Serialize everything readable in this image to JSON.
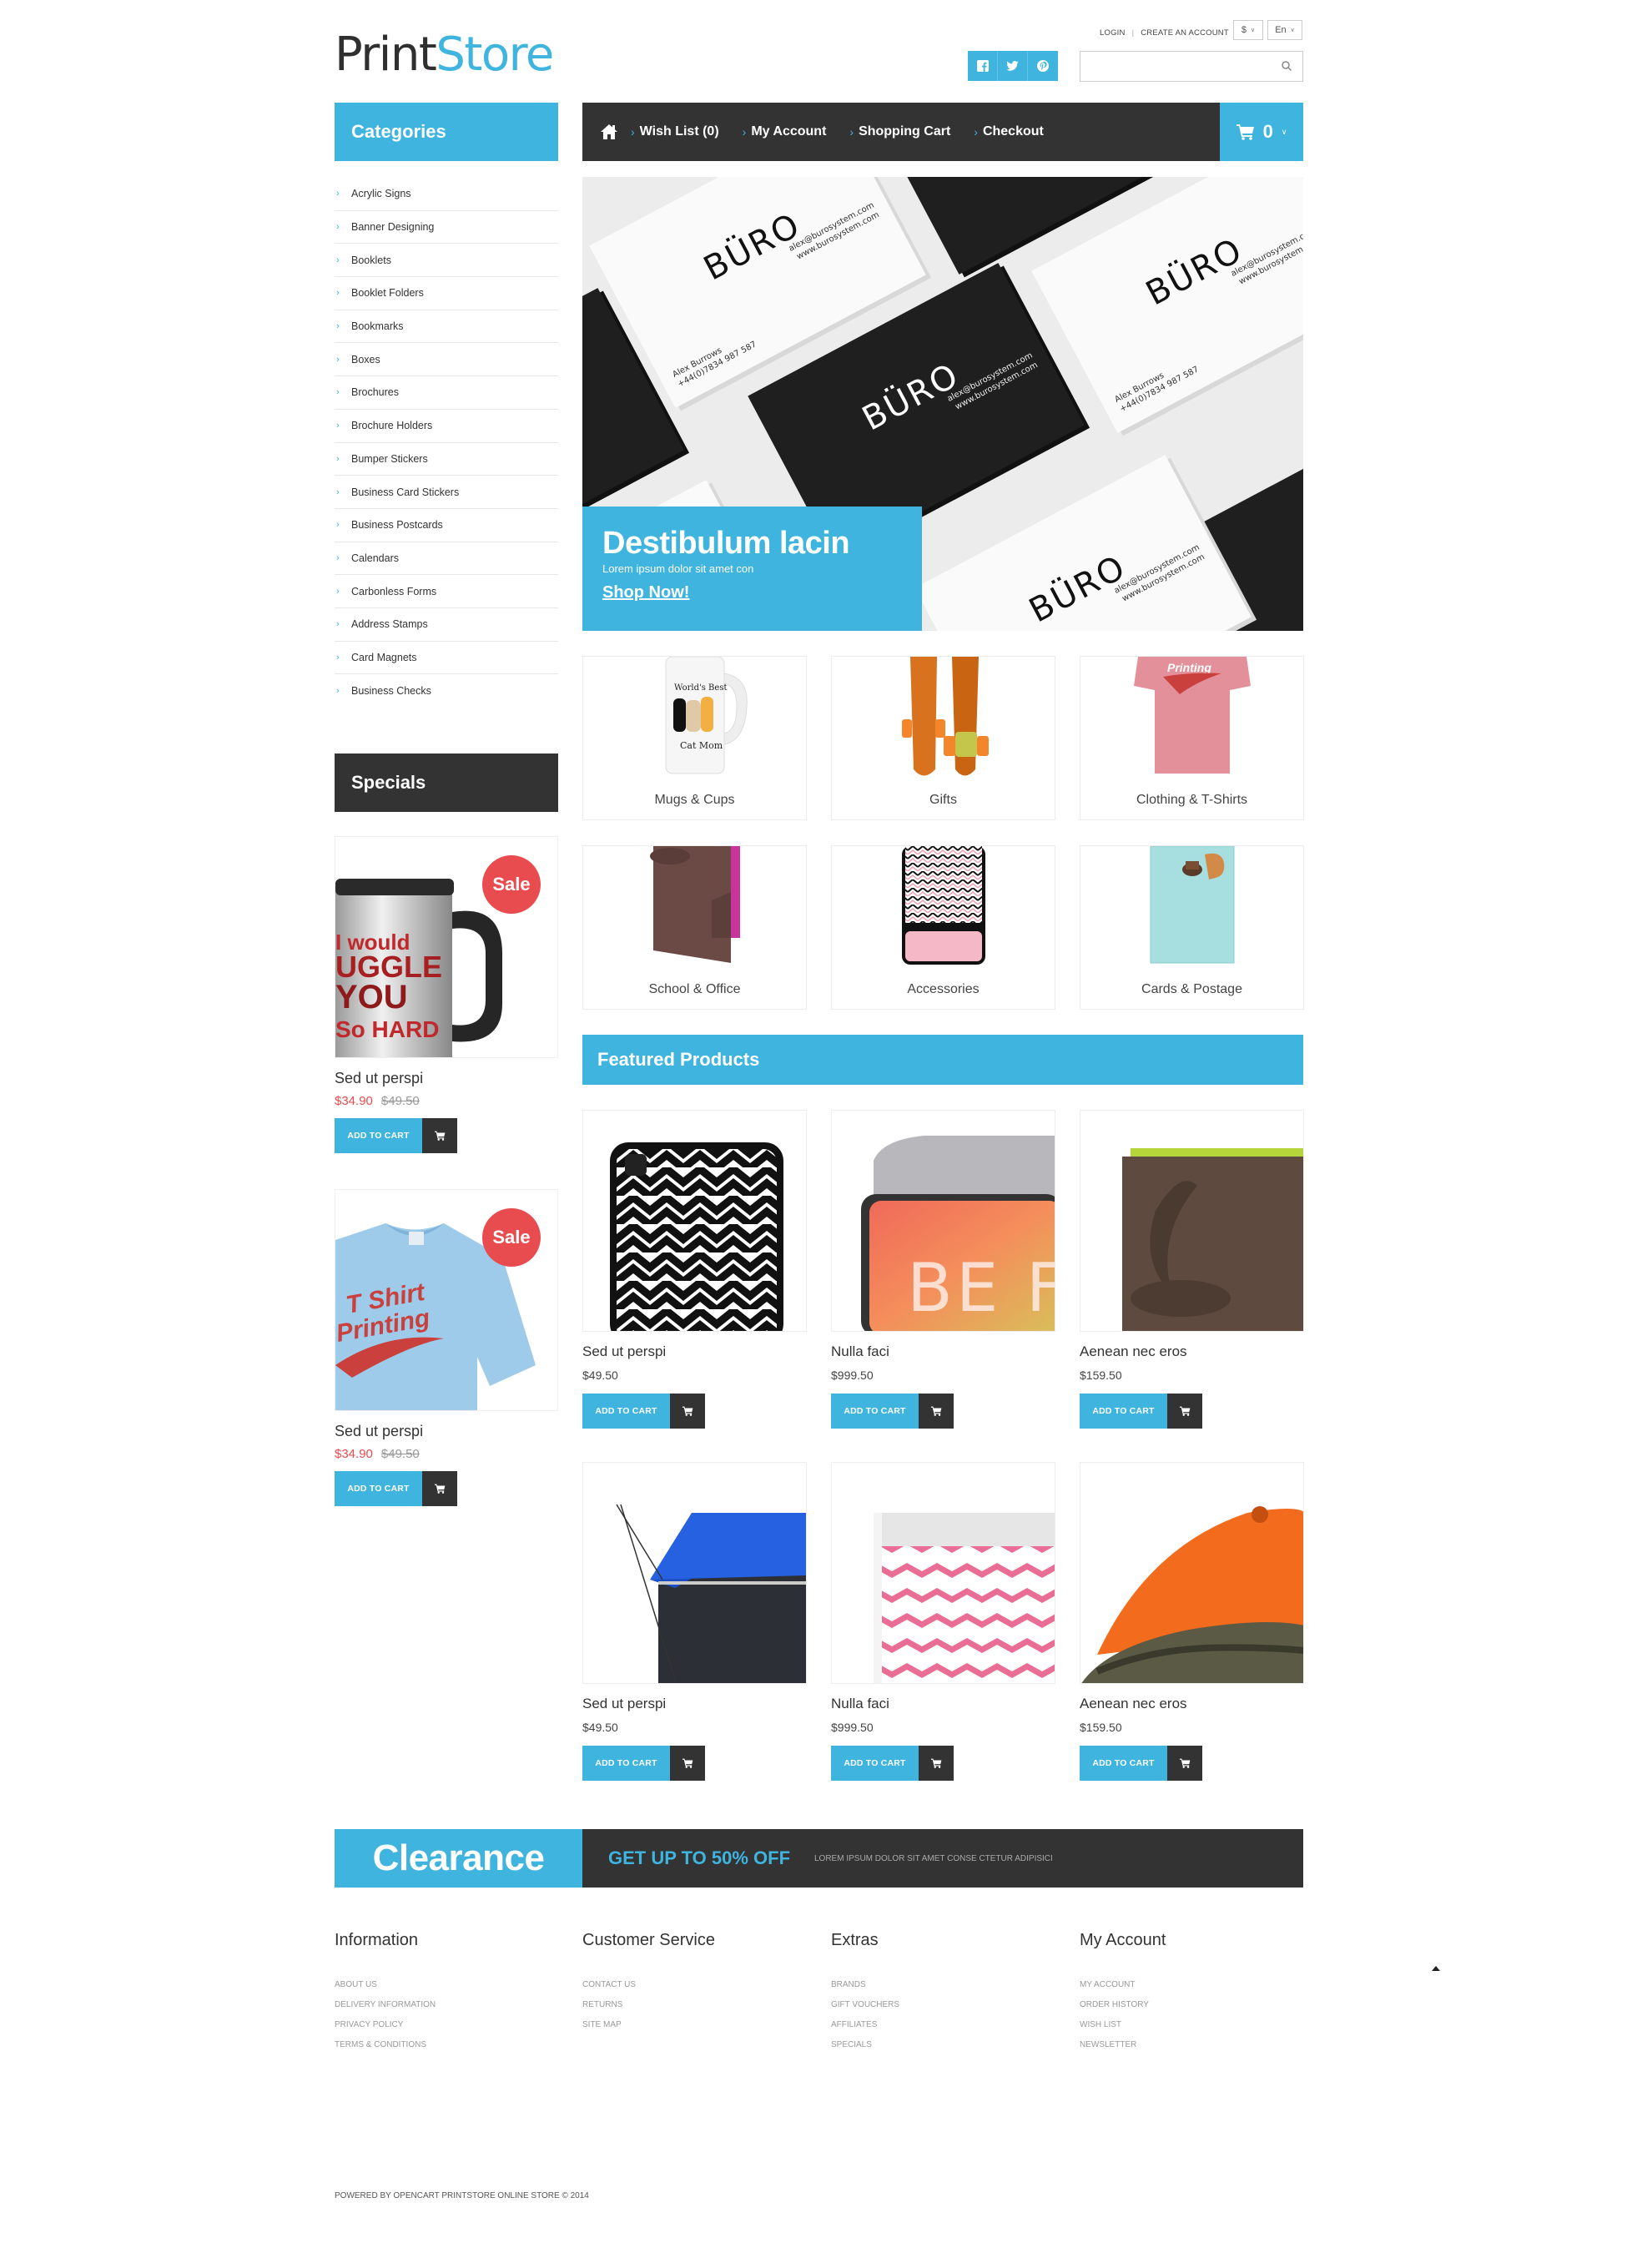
{
  "header": {
    "logo_part1": "Print",
    "logo_part2": "Store",
    "login": "LOGIN",
    "create_account": "CREATE AN ACCOUNT",
    "currency": "$",
    "language": "En",
    "search_placeholder": "",
    "social": [
      {
        "icon": "facebook-icon",
        "glyph": "f"
      },
      {
        "icon": "twitter-icon",
        "glyph": "t"
      },
      {
        "icon": "pinterest-icon",
        "glyph": "p"
      }
    ]
  },
  "nav": {
    "links": [
      "Wish List (0)",
      "My Account",
      "Shopping Cart",
      "Checkout"
    ],
    "cart_count": "0"
  },
  "sidebar": {
    "categories_title": "Categories",
    "categories": [
      "Acrylic Signs",
      "Banner Designing",
      "Booklets",
      "Booklet Folders",
      "Bookmarks",
      "Boxes",
      "Brochures",
      "Brochure Holders",
      "Bumper Stickers",
      "Business Card Stickers",
      "Business Postcards",
      "Calendars",
      "Carbonless Forms",
      "Address Stamps",
      "Card Magnets",
      "Business Checks"
    ],
    "specials_title": "Specials",
    "specials": [
      {
        "name": "Sed ut perspi",
        "price_new": "$34.90",
        "price_old": "$49.50",
        "badge": "Sale",
        "image": "travel-mug",
        "button": "ADD TO CART"
      },
      {
        "name": "Sed ut perspi",
        "price_new": "$34.90",
        "price_old": "$49.50",
        "badge": "Sale",
        "image": "t-shirt",
        "button": "ADD TO CART"
      }
    ]
  },
  "hero": {
    "title": "Destibulum lacin",
    "subtitle": "Lorem ipsum dolor sit amet con",
    "cta": "Shop Now!",
    "card_brand": "BÜRO",
    "card_email": "alex@burosystem.com",
    "card_web": "www.burosystem.com",
    "card_name": "Alex Burrows",
    "card_phone": "+44(0)7834 987 587"
  },
  "category_tiles": [
    {
      "label": "Mugs & Cups",
      "image": "mug"
    },
    {
      "label": "Gifts",
      "image": "skateboards"
    },
    {
      "label": "Clothing & T-Shirts",
      "image": "pink-tshirt"
    },
    {
      "label": "School & Office",
      "image": "folder"
    },
    {
      "label": "Accessories",
      "image": "phone-case"
    },
    {
      "label": "Cards & Postage",
      "image": "card"
    }
  ],
  "featured": {
    "title": "Featured Products",
    "button": "ADD TO CART",
    "products": [
      {
        "name": "Sed ut perspi",
        "price": "$49.50",
        "image": "chevron-phone-case"
      },
      {
        "name": "Nulla faci",
        "price": "$999.50",
        "image": "laptop-sleeve"
      },
      {
        "name": "Aenean nec eros",
        "price": "$159.50",
        "image": "brown-folder"
      },
      {
        "name": "Sed ut perspi",
        "price": "$49.50",
        "image": "drawstring-bag"
      },
      {
        "name": "Nulla faci",
        "price": "$999.50",
        "image": "chevron-box"
      },
      {
        "name": "Aenean nec eros",
        "price": "$159.50",
        "image": "camo-cap"
      }
    ]
  },
  "clearance": {
    "title": "Clearance",
    "offer": "GET UP TO 50% OFF",
    "text": "LOREM IPSUM DOLOR SIT AMET CONSE CTETUR ADIPISICI"
  },
  "footer": {
    "columns": [
      {
        "title": "Information",
        "links": [
          "ABOUT US",
          "DELIVERY INFORMATION",
          "PRIVACY POLICY",
          "TERMS & CONDITIONS"
        ]
      },
      {
        "title": "Customer Service",
        "links": [
          "CONTACT US",
          "RETURNS",
          "SITE MAP"
        ]
      },
      {
        "title": "Extras",
        "links": [
          "BRANDS",
          "GIFT VOUCHERS",
          "AFFILIATES",
          "SPECIALS"
        ]
      },
      {
        "title": "My Account",
        "links": [
          "MY ACCOUNT",
          "ORDER HISTORY",
          "WISH LIST",
          "NEWSLETTER"
        ]
      }
    ],
    "powered": "POWERED BY OPENCART PRINTSTORE ONLINE STORE © 2014"
  },
  "colors": {
    "accent": "#3eb4df",
    "dark": "#333333",
    "sale": "#e84c4f"
  }
}
